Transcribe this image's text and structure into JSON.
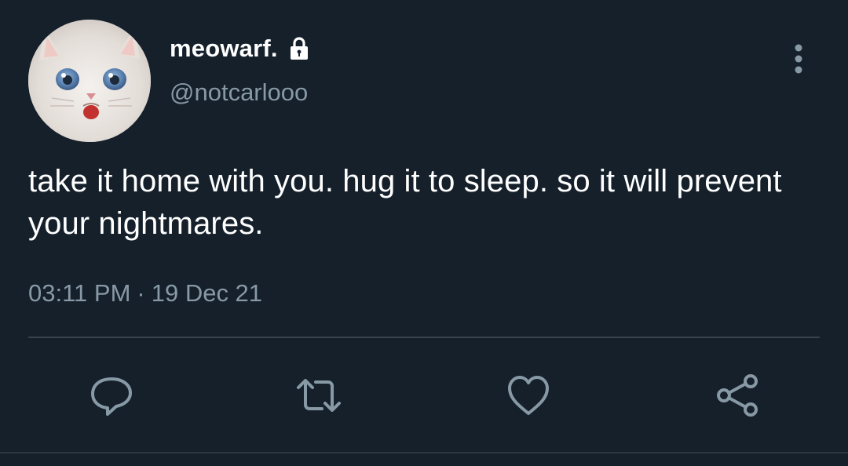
{
  "tweet": {
    "display_name": "meowarf.",
    "handle": "@notcarlooo",
    "text": "take it home with you. hug it to sleep. so it will prevent your nightmares.",
    "time": "03:11 PM",
    "separator": "·",
    "date": "19 Dec 21"
  },
  "icons": {
    "lock": "lock-icon",
    "more": "more-vertical-icon",
    "reply": "reply-icon",
    "retweet": "retweet-icon",
    "like": "heart-icon",
    "share": "share-icon"
  },
  "colors": {
    "background": "#15202b",
    "primary_text": "#ffffff",
    "secondary_text": "#8899a6",
    "divider": "#38444d"
  }
}
